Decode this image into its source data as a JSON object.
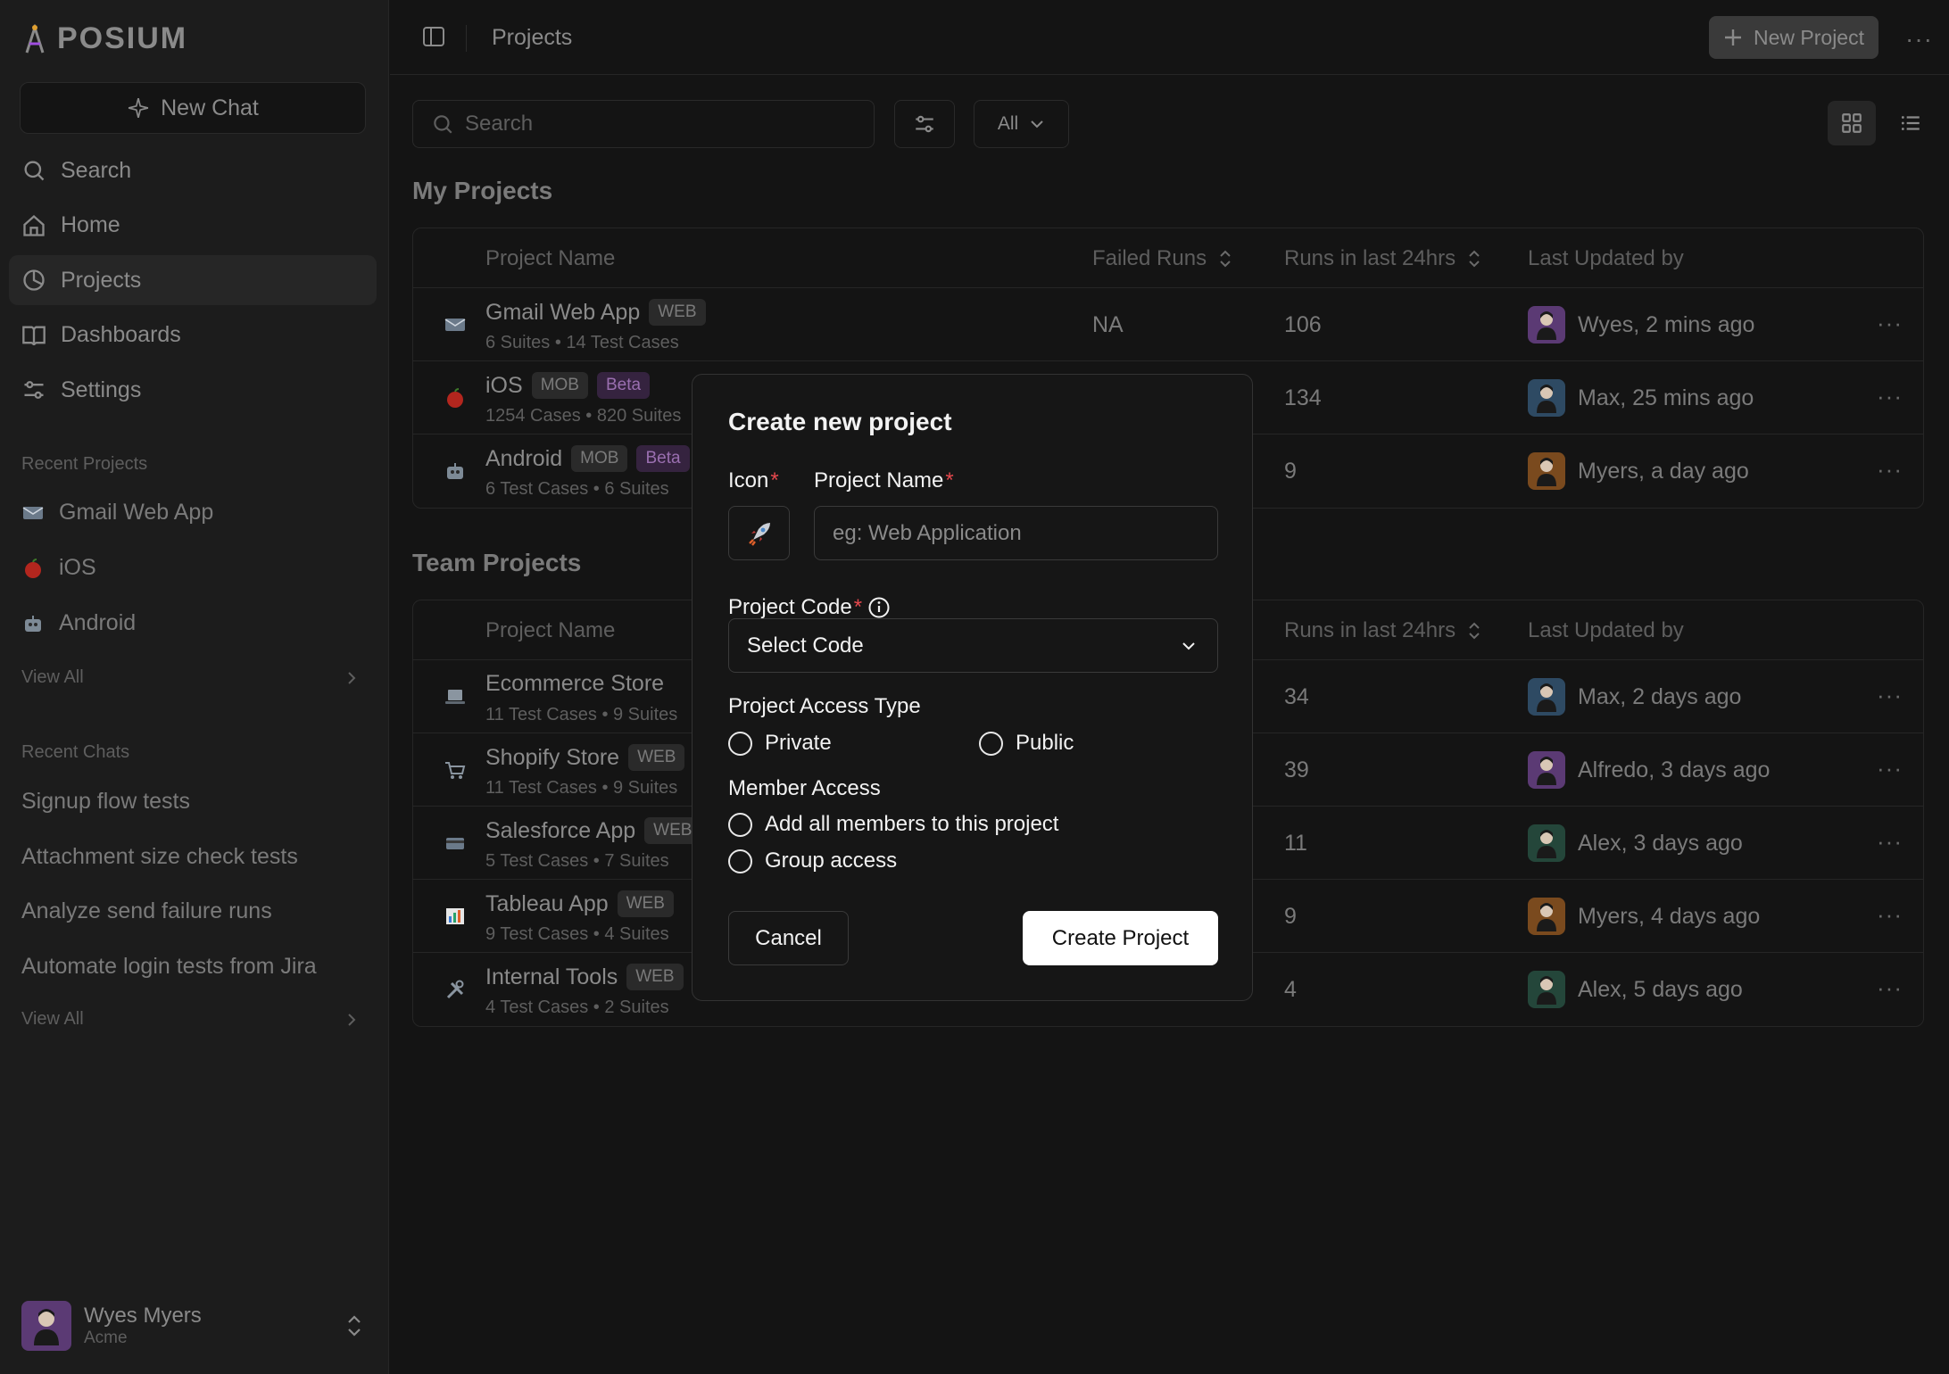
{
  "app": {
    "name": "POSIUM"
  },
  "sidebar": {
    "new_chat_label": "New Chat",
    "nav": [
      {
        "label": "Search",
        "icon": "search-icon"
      },
      {
        "label": "Home",
        "icon": "home-icon"
      },
      {
        "label": "Projects",
        "icon": "projects-icon",
        "active": true
      },
      {
        "label": "Dashboards",
        "icon": "book-icon"
      },
      {
        "label": "Settings",
        "icon": "settings-icon"
      }
    ],
    "recent_projects_label": "Recent Projects",
    "recent_projects": [
      {
        "label": "Gmail Web App",
        "icon": "email-icon"
      },
      {
        "label": "iOS",
        "icon": "apple-icon"
      },
      {
        "label": "Android",
        "icon": "robot-icon"
      }
    ],
    "view_all_label": "View All",
    "recent_chats_label": "Recent Chats",
    "recent_chats": [
      "Signup flow tests",
      "Attachment size check tests",
      "Analyze send failure runs",
      "Automate login tests from Jira"
    ],
    "user": {
      "name": "Wyes Myers",
      "org": "Acme"
    }
  },
  "topbar": {
    "breadcrumb": "Projects",
    "new_project_label": "New Project"
  },
  "filters": {
    "search_placeholder": "Search",
    "scope": "All"
  },
  "my_projects": {
    "title": "My Projects",
    "columns": {
      "name": "Project Name",
      "failed": "Failed Runs",
      "runs": "Runs in last 24hrs",
      "updated": "Last Updated by"
    },
    "rows": [
      {
        "name": "Gmail Web App",
        "badges": [
          "WEB"
        ],
        "sub": "6 Suites • 14 Test Cases",
        "failed": "NA",
        "runs": "106",
        "updated": "Wyes, 2 mins ago",
        "avatar_color": "#5b3a74",
        "icon": "email-icon"
      },
      {
        "name": "iOS",
        "badges": [
          "MOB",
          "Beta"
        ],
        "sub": "1254 Cases • 820 Suites",
        "failed": "",
        "runs": "134",
        "updated": "Max, 25 mins ago",
        "avatar_color": "#2e4a63",
        "icon": "apple-icon"
      },
      {
        "name": "Android",
        "badges": [
          "MOB",
          "Beta"
        ],
        "sub": "6 Test Cases • 6 Suites",
        "failed": "",
        "runs": "9",
        "updated": "Myers, a day ago",
        "avatar_color": "#7a4a1e",
        "icon": "robot-icon"
      }
    ]
  },
  "team_projects": {
    "title": "Team Projects",
    "columns": {
      "name": "Project Name",
      "runs": "Runs in last 24hrs",
      "updated": "Last Updated by"
    },
    "rows": [
      {
        "name": "Ecommerce Store",
        "badges": [],
        "sub": "11 Test Cases • 9 Suites",
        "runs": "34",
        "updated": "Max, 2 days ago",
        "avatar_color": "#2e4a63",
        "icon": "laptop-icon"
      },
      {
        "name": "Shopify Store",
        "badges": [
          "WEB"
        ],
        "sub": "11 Test Cases • 9 Suites",
        "runs": "39",
        "updated": "Alfredo, 3 days ago",
        "avatar_color": "#5b3a74",
        "icon": "cart-icon"
      },
      {
        "name": "Salesforce App",
        "badges": [
          "WEB"
        ],
        "sub": "5 Test Cases • 7 Suites",
        "runs": "11",
        "updated": "Alex, 3 days ago",
        "avatar_color": "#24463a",
        "icon": "card-icon"
      },
      {
        "name": "Tableau App",
        "badges": [
          "WEB"
        ],
        "sub": "9 Test Cases • 4 Suites",
        "runs": "9",
        "updated": "Myers, 4 days ago",
        "avatar_color": "#7a4a1e",
        "icon": "chart-icon"
      },
      {
        "name": "Internal Tools",
        "badges": [
          "WEB"
        ],
        "sub": "4 Test Cases • 2 Suites",
        "runs": "4",
        "updated": "Alex, 5 days ago",
        "avatar_color": "#24463a",
        "icon": "tools-icon"
      }
    ]
  },
  "modal": {
    "title": "Create new project",
    "icon_label": "Icon",
    "name_label": "Project Name",
    "name_placeholder": "eg: Web Application",
    "code_label": "Project Code",
    "code_value": "Select Code",
    "access_type_label": "Project Access Type",
    "access_options": [
      "Private",
      "Public"
    ],
    "member_access_label": "Member Access",
    "member_options": [
      "Add all members to this project",
      "Group access"
    ],
    "cancel_label": "Cancel",
    "create_label": "Create Project",
    "required_mark": "*"
  }
}
